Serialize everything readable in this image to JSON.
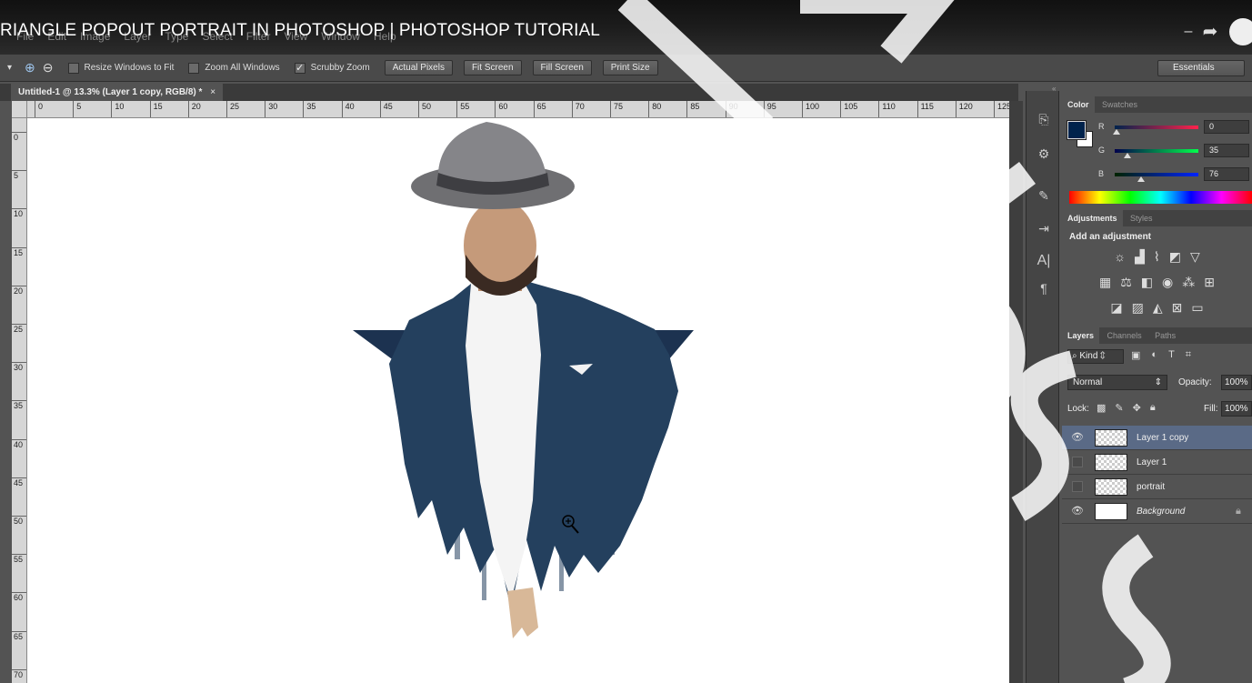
{
  "video": {
    "title": "RIANGLE POPOUT PORTRAIT IN PHOTOSHOP | PHOTOSHOP TUTORIAL"
  },
  "menu": {
    "items": [
      "File",
      "Edit",
      "Image",
      "Layer",
      "Type",
      "Select",
      "Filter",
      "View",
      "Window",
      "Help"
    ]
  },
  "options": {
    "resize_windows_label": "Resize Windows to Fit",
    "zoom_all_label": "Zoom All Windows",
    "scrubby_zoom_label": "Scrubby Zoom",
    "actual_pixels": "Actual Pixels",
    "fit_screen": "Fit Screen",
    "fill_screen": "Fill Screen",
    "print_size": "Print Size",
    "workspace": "Essentials"
  },
  "document": {
    "tab_title": "Untitled-1 @ 13.3% (Layer 1 copy, RGB/8) *",
    "ruler_top": [
      "0",
      "5",
      "10",
      "15",
      "20",
      "25",
      "30",
      "35",
      "40",
      "45",
      "50",
      "55",
      "60",
      "65",
      "70",
      "75",
      "80",
      "85",
      "90",
      "95",
      "100",
      "105",
      "110",
      "115",
      "120",
      "125"
    ],
    "ruler_left": [
      "0",
      "5",
      "10",
      "15",
      "20",
      "25",
      "30",
      "35",
      "40",
      "45",
      "50",
      "55",
      "60",
      "65",
      "70"
    ]
  },
  "color_panel": {
    "tabs": [
      "Color",
      "Swatches"
    ],
    "r_label": "R",
    "g_label": "G",
    "b_label": "B",
    "r": 0,
    "g": 35,
    "b": 76,
    "foreground_color": "#00234c",
    "background_color": "#ffffff"
  },
  "adjustments_panel": {
    "tabs": [
      "Adjustments",
      "Styles"
    ],
    "heading": "Add an adjustment"
  },
  "layers_panel": {
    "tabs": [
      "Layers",
      "Channels",
      "Paths"
    ],
    "filter_kind": "Kind",
    "blend_mode": "Normal",
    "opacity_label": "Opacity:",
    "opacity_value": "100%",
    "lock_label": "Lock:",
    "fill_label": "Fill:",
    "fill_value": "100%",
    "layers": [
      {
        "name": "Layer 1 copy",
        "visible": true,
        "selected": true
      },
      {
        "name": "Layer 1",
        "visible": false,
        "selected": false
      },
      {
        "name": "portrait",
        "visible": false,
        "selected": false
      },
      {
        "name": "Background",
        "visible": true,
        "selected": false,
        "locked": true
      }
    ]
  },
  "colors": {
    "accent": "#5a6a86",
    "triangle": "#1c3250",
    "jacket": "#24405e"
  }
}
